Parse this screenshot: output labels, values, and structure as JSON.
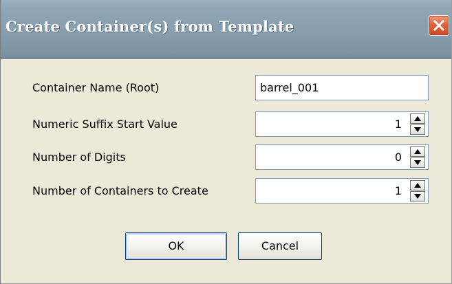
{
  "window": {
    "title": "Create Container(s) from Template"
  },
  "form": {
    "container_name_label": "Container Name (Root)",
    "container_name_value": "barrel_001",
    "suffix_start_label": "Numeric Suffix Start Value",
    "suffix_start_value": "1",
    "digits_label": "Number of Digits",
    "digits_value": "0",
    "count_label": "Number of Containers to Create",
    "count_value": "1"
  },
  "buttons": {
    "ok_label": "OK",
    "cancel_label": "Cancel"
  },
  "icons": {
    "close": "close-icon",
    "spin_up": "arrow-up-icon",
    "spin_down": "arrow-down-icon"
  },
  "colors": {
    "title_bar": "#879fae",
    "close_button": "#e0603a",
    "dialog_background": "#ece9d8",
    "field_border": "#7f9db9"
  }
}
